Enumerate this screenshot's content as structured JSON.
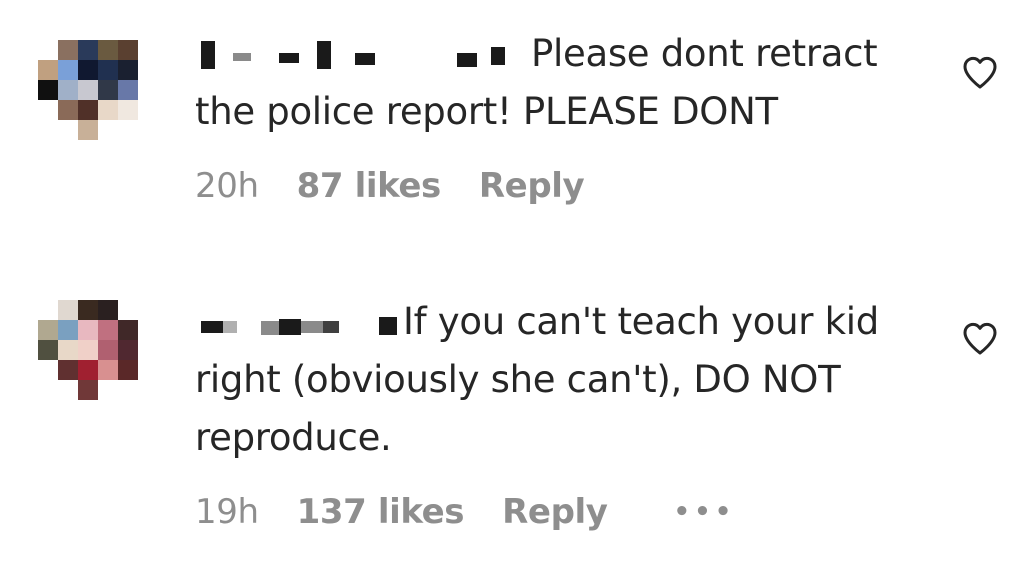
{
  "comments": [
    {
      "text": "Please dont retract the police report! PLEASE DONT",
      "time": "20h",
      "likes": "87 likes",
      "reply": "Reply",
      "icons": {
        "avatar": "pixelated-avatar",
        "like": "heart-outline-icon"
      }
    },
    {
      "text": "If you can't teach your kid right (obviously she can't), DO NOT reproduce.",
      "time": "19h",
      "likes": "137 likes",
      "reply": "Reply",
      "more": "•••",
      "icons": {
        "avatar": "pixelated-avatar",
        "like": "heart-outline-icon",
        "more": "more-options-icon"
      }
    }
  ],
  "colors": {
    "text": "#262626",
    "meta": "#8e8e8e",
    "background": "#ffffff"
  }
}
